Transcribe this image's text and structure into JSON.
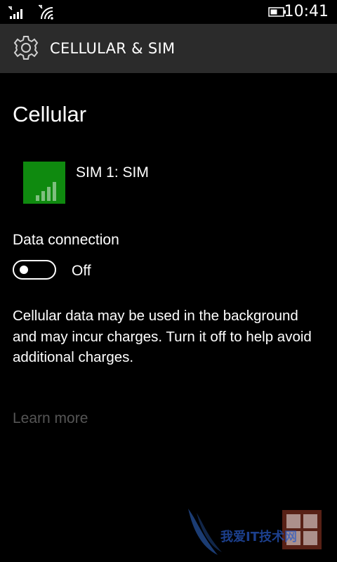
{
  "status_bar": {
    "time": "10:41",
    "icons": [
      "signal-icon",
      "wifi-icon",
      "battery-icon"
    ]
  },
  "header": {
    "title": "CELLULAR & SIM",
    "icon": "gear-icon"
  },
  "section": {
    "title": "Cellular"
  },
  "sim": {
    "label": "SIM 1: SIM",
    "tile_color": "#0f8a0f",
    "icon": "signal-bars-icon"
  },
  "data_connection": {
    "label": "Data connection",
    "state": "Off",
    "enabled": false
  },
  "description": "Cellular data may be used in the background and may incur charges. Turn it off to help avoid additional charges.",
  "learn_more": "Learn more",
  "watermark": {
    "text": "我爱IT技术网"
  },
  "colors": {
    "background": "#000000",
    "header_background": "#2b2b2b",
    "text": "#ffffff",
    "disabled_text": "#555555"
  }
}
